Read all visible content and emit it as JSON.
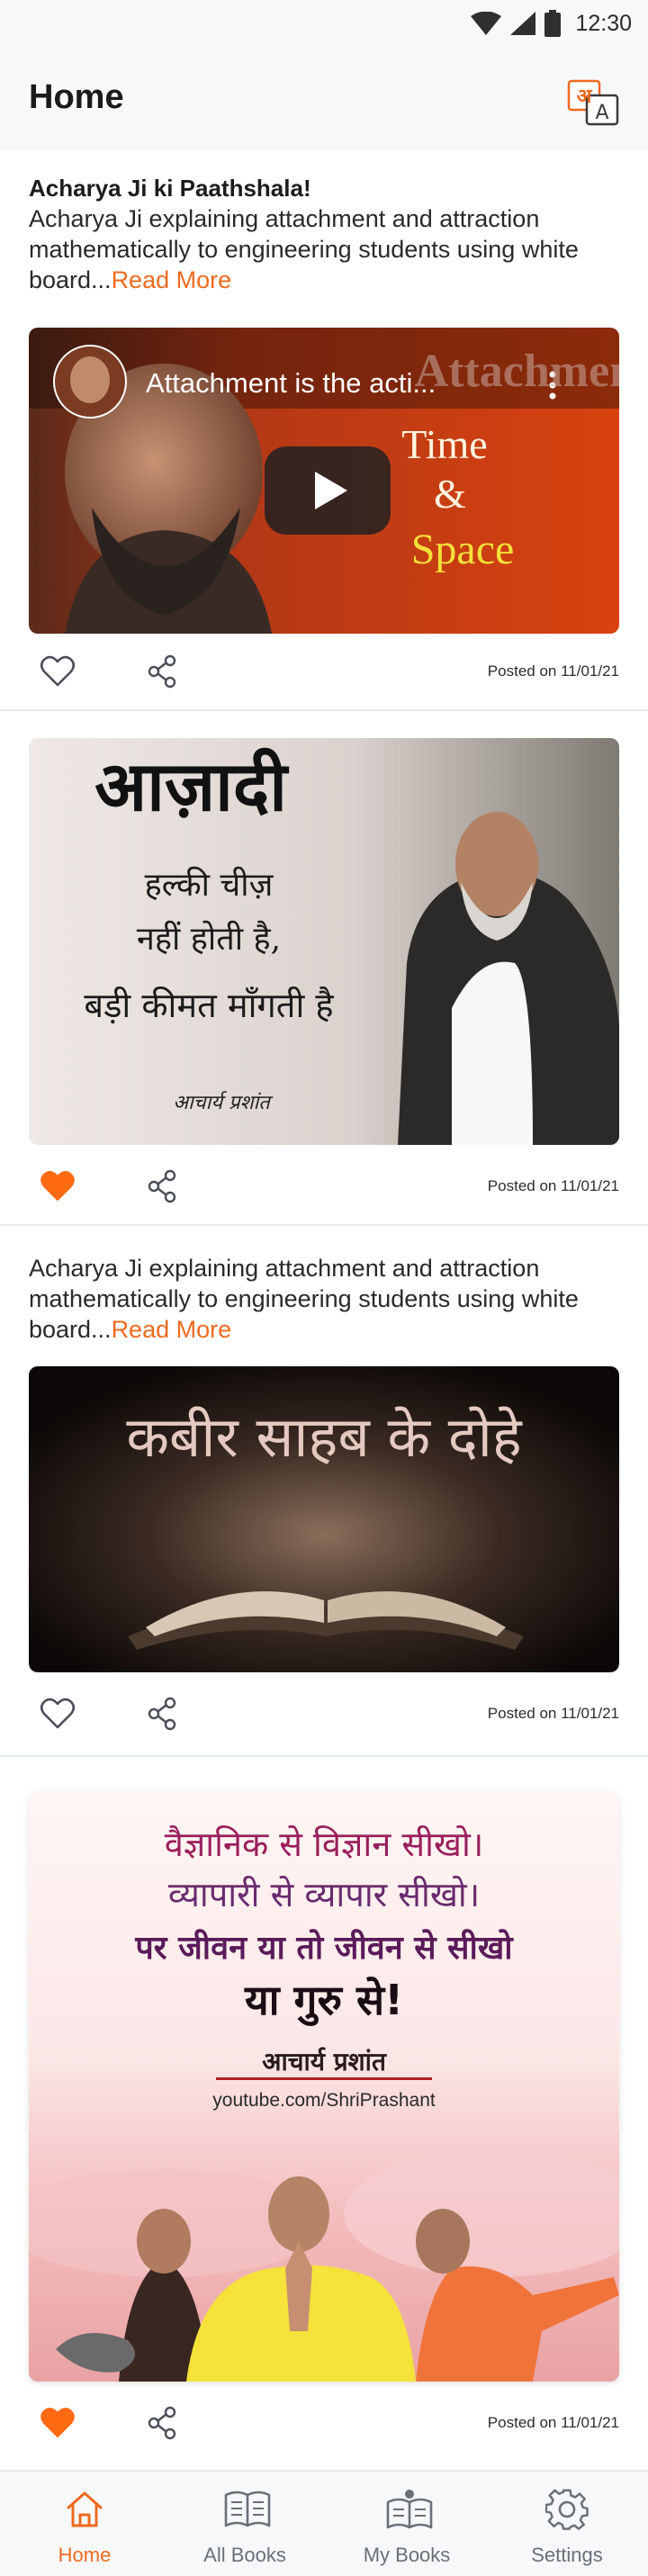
{
  "status_bar": {
    "time": "12:30",
    "icons": [
      "wifi-icon",
      "cellular-icon",
      "battery-icon"
    ]
  },
  "header": {
    "title": "Home",
    "language_icon": "hindi-english-translate-icon",
    "language_icon_glyphs": [
      "अ",
      "A"
    ]
  },
  "posts": [
    {
      "title": "Acharya Ji ki Paathshala!",
      "description": "Acharya Ji explaining attachment and attraction mathematically to engineering students using white board...",
      "read_more": "Read More",
      "video": {
        "title": "Attachment is the acti...",
        "overlay_text": [
          "Attachment",
          "Time",
          "&",
          "Space"
        ]
      },
      "liked": false,
      "posted": "Posted on 11/01/21"
    },
    {
      "image_text": [
        "आज़ादी",
        "हल्की चीज़",
        "नहीं होती है,",
        "बड़ी कीमत माँगती है",
        "आचार्य प्रशांत"
      ],
      "liked": true,
      "posted": "Posted on 11/01/21"
    },
    {
      "description": "Acharya Ji explaining attachment and attraction mathematically to engineering students using white board...",
      "read_more": "Read More",
      "image_text": [
        "कबीर साहब के दोहे"
      ],
      "liked": false,
      "posted": "Posted on 11/01/21"
    },
    {
      "image_text": [
        "वैज्ञानिक से विज्ञान सीखो।",
        "व्यापारी से व्यापार सीखो।",
        "पर जीवन या तो जीवन से सीखो",
        "या गुरु से!",
        "आचार्य प्रशांत",
        "youtube.com/ShriPrashant"
      ],
      "liked": true,
      "posted": "Posted on 11/01/21"
    }
  ],
  "tabs": [
    {
      "label": "Home",
      "icon": "home-icon",
      "active": true
    },
    {
      "label": "All Books",
      "icon": "open-book-icon",
      "active": false
    },
    {
      "label": "My Books",
      "icon": "reader-book-icon",
      "active": false
    },
    {
      "label": "Settings",
      "icon": "gear-icon",
      "active": false
    }
  ],
  "colors": {
    "accent": "#EE6A1F",
    "liked": "#FF6A13",
    "header_bg": "#F6F8FA",
    "text": "#1D1D1F"
  }
}
